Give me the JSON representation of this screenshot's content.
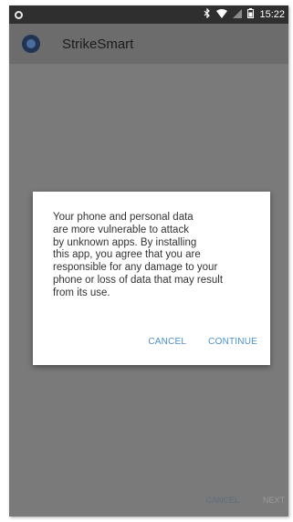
{
  "status_bar": {
    "time": "15:22",
    "icons": [
      "bluetooth-icon",
      "wifi-icon",
      "signal-icon",
      "battery-icon"
    ]
  },
  "app_bar": {
    "title": "StrikeSmart",
    "logo": "app-logo-icon"
  },
  "dialog": {
    "message": "Your phone and personal data\nare more vulnerable to attack\nby unknown apps. By installing\nthis app, you agree that you are\nresponsible for any damage to your\nphone or loss of data that may result\nfrom its use.",
    "cancel_label": "CANCEL",
    "continue_label": "CONTINUE"
  },
  "footer": {
    "cancel_label": "CANCEL",
    "next_label": "NEXT"
  },
  "colors": {
    "accent": "#4a8fcf",
    "scrim": "#7a7a7a",
    "status_bar": "#2f2f2f"
  }
}
